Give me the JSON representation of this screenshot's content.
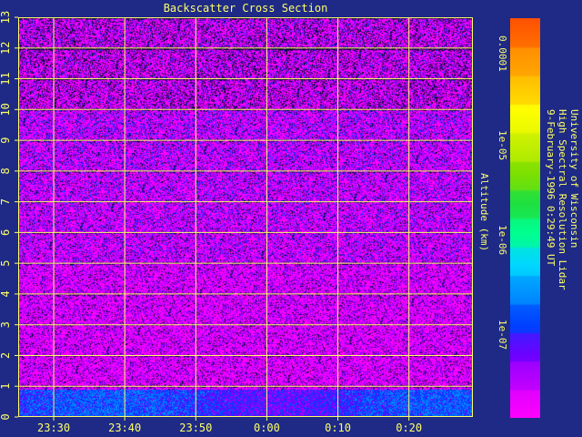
{
  "chart_data": {
    "type": "heatmap",
    "title": "Backscatter Cross Section",
    "ylabel": "Altitude (km)",
    "xlabel": "",
    "x_tick_labels": [
      "23:30",
      "23:40",
      "23:50",
      "0:00",
      "0:10",
      "0:20"
    ],
    "x_tick_minutes": [
      30,
      40,
      50,
      60,
      70,
      80
    ],
    "xlim_minutes": [
      25,
      89
    ],
    "y_tick_labels": [
      "0",
      "1",
      "2",
      "3",
      "4",
      "5",
      "6",
      "7",
      "8",
      "9",
      "10",
      "11",
      "12",
      "13"
    ],
    "ylim_km": [
      0,
      13
    ],
    "grid": true,
    "grid_color": "#ffff66",
    "colorbar": {
      "scale": "log",
      "range": [
        1.5e-08,
        0.00025
      ],
      "tick_values": [
        1e-07,
        1e-06,
        1e-05,
        0.0001
      ],
      "tick_labels": [
        "1e-07",
        "1e-06",
        "1e-05",
        "0.0001"
      ],
      "colors": [
        "#ff00ff",
        "#c000ff",
        "#7000ff",
        "#0040ff",
        "#0090ff",
        "#00d8ff",
        "#00ff90",
        "#20e040",
        "#80e000",
        "#c8f000",
        "#ffff00",
        "#ffc000",
        "#ff9000",
        "#ff5000"
      ]
    },
    "layers": [
      {
        "altitude_km": [
          0,
          0.9
        ],
        "description_level": 1.5e-07
      },
      {
        "altitude_km": [
          0.9,
          5
        ],
        "description_level": 2.5e-08
      },
      {
        "altitude_km": [
          5,
          10
        ],
        "description_level": 3e-08
      },
      {
        "altitude_km": [
          10,
          13
        ],
        "description_level": 2e-08
      }
    ]
  },
  "credits": {
    "line1": "University of Wisconsin",
    "line2": "High Spectral Resolution Lidar",
    "line3": "9-February-1996  0:29:49 UT"
  }
}
